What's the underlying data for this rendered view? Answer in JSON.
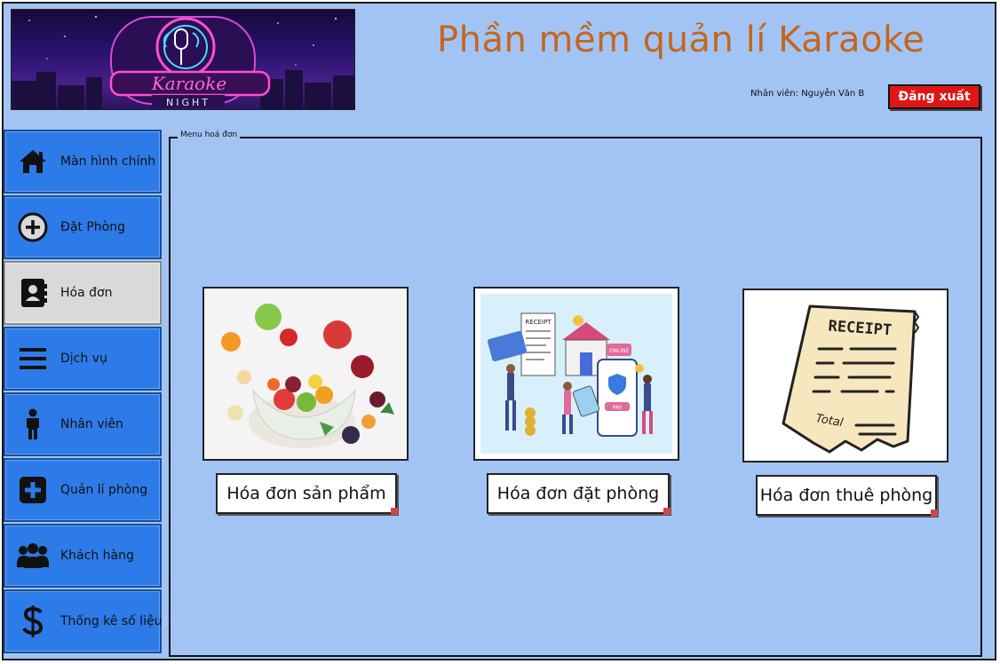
{
  "header": {
    "logo_text": "Karaoke",
    "logo_subtext": "NIGHT",
    "title": "Phần mềm quản lí Karaoke",
    "employee_label": "Nhân viên: Nguyễn Văn B",
    "logout_label": "Đăng xuất"
  },
  "sidebar": {
    "items": [
      {
        "label": "Màn hình chính",
        "icon": "home-icon"
      },
      {
        "label": "Đặt Phòng",
        "icon": "plus-circle-icon"
      },
      {
        "label": "Hóa đơn",
        "icon": "contact-book-icon",
        "active": true
      },
      {
        "label": "Dịch vụ",
        "icon": "menu-icon"
      },
      {
        "label": "Nhân viên",
        "icon": "person-icon"
      },
      {
        "label": "Quản lí phòng",
        "icon": "plus-square-icon"
      },
      {
        "label": "Khách hàng",
        "icon": "users-icon"
      },
      {
        "label": "Thống kê số liệu",
        "icon": "dollar-icon"
      }
    ]
  },
  "content": {
    "legend": "Menu hoá đơn",
    "cards": [
      {
        "label": "Hóa đơn sản phẩm",
        "image": "fruit-salad-image"
      },
      {
        "label": "Hóa đơn đặt phòng",
        "image": "online-payment-image"
      },
      {
        "label": "Hóa đơn thuê phòng",
        "image": "paper-receipt-image"
      }
    ],
    "receipt_word": "RECEIPT",
    "total_word": "Total",
    "online_word": "ONLINE",
    "pay_word": "PAY"
  },
  "colors": {
    "background": "#a2c4f4",
    "title": "#c4661f",
    "nav": "#2d7be8",
    "nav_active": "#d9d9d9",
    "logout": "#e01515"
  }
}
